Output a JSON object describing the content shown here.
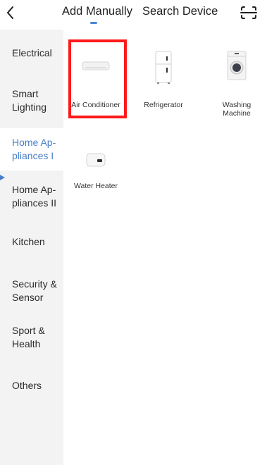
{
  "header": {
    "back_icon": "chevron-left-icon",
    "tabs": [
      {
        "label": "Add Manually",
        "active": true
      },
      {
        "label": "Search Device",
        "active": false
      }
    ],
    "scan_icon": "scan-icon",
    "accent_color": "#4a86d8"
  },
  "sidebar": {
    "items": [
      {
        "label": "Electrical",
        "active": false
      },
      {
        "label": "Smart Lighting",
        "active": false
      },
      {
        "label": "Home Ap-pliances I",
        "active": true
      },
      {
        "label": "Home Ap-pliances II",
        "active": false
      },
      {
        "label": "Kitchen",
        "active": false
      },
      {
        "label": "Security & Sensor",
        "active": false
      },
      {
        "label": "Sport & Health",
        "active": false
      },
      {
        "label": "Others",
        "active": false
      }
    ]
  },
  "devices": [
    {
      "label": "Air Conditioner",
      "icon": "air-conditioner-icon",
      "highlighted": true
    },
    {
      "label": "Refrigerator",
      "icon": "refrigerator-icon",
      "highlighted": false
    },
    {
      "label": "Washing Machine",
      "icon": "washing-machine-icon",
      "highlighted": false
    },
    {
      "label": "Water Heater",
      "icon": "water-heater-icon",
      "highlighted": false
    }
  ],
  "highlight_color": "#ff1a1a"
}
